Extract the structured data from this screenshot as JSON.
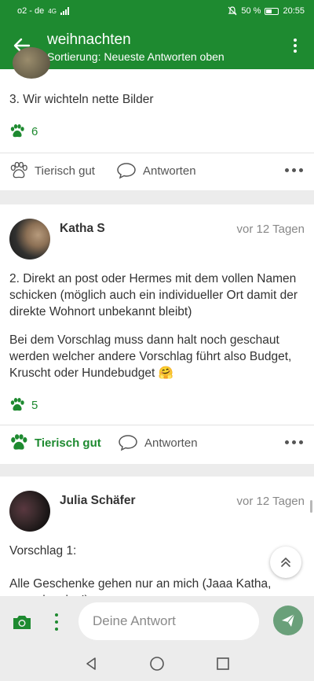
{
  "status_bar": {
    "carrier": "o2 - de",
    "network": "4G",
    "battery": "50 %",
    "time": "20:55"
  },
  "app_bar": {
    "title": "weihnachten",
    "subtitle": "Sortierung: Neueste Antworten oben"
  },
  "posts": [
    {
      "text": "3. Wir wichteln nette Bilder",
      "likes": "6",
      "like_label": "Tierisch gut",
      "like_active": false,
      "reply_label": "Antworten"
    },
    {
      "author": "Katha S",
      "time": "vor 12 Tagen",
      "paragraphs": [
        "2. Direkt an post oder Hermes mit dem vollen Namen schicken (möglich auch ein individueller Ort damit der direkte Wohnort unbekannt bleibt)",
        "Bei dem Vorschlag muss dann halt noch geschaut werden welcher andere Vorschlag führt also Budget, Kruscht oder Hundebudget 🤗"
      ],
      "likes": "5",
      "like_label": "Tierisch gut",
      "like_active": true,
      "reply_label": "Antworten"
    },
    {
      "author": "Julia Schäfer",
      "time": "vor 12 Tagen",
      "paragraphs": [
        "Vorschlag 1:",
        "Alle Geschenke gehen nur an mich (Jaaa Katha, ausnahmslos!)"
      ]
    }
  ],
  "composer": {
    "placeholder": "Deine Antwort"
  },
  "colors": {
    "primary": "#1e8a30",
    "send_button": "#6aa07a"
  },
  "icons": [
    "back-arrow-icon",
    "overflow-menu-icon",
    "paw-icon",
    "reply-bubble-icon",
    "more-icon",
    "scroll-top-icon",
    "camera-icon",
    "send-icon",
    "nav-back-icon",
    "nav-home-icon",
    "nav-recents-icon"
  ]
}
